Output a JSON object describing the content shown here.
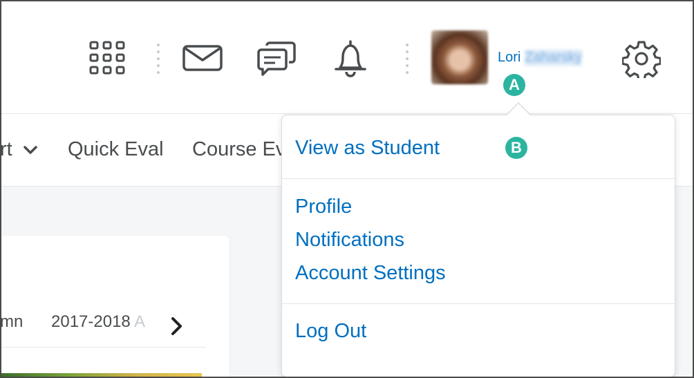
{
  "header": {
    "user": {
      "first_name": "Lori",
      "last_name_redacted": "Zaharsky"
    },
    "icons": [
      "waffle-grid-icon",
      "mail-icon",
      "chat-icon",
      "bell-icon",
      "gear-icon"
    ],
    "badges": {
      "a": "A",
      "b": "B"
    }
  },
  "navbar": {
    "items": [
      "rt",
      "Quick Eval",
      "Course Ev"
    ]
  },
  "card": {
    "left_text": "mn",
    "term": "2017-2018",
    "term_faded": "A"
  },
  "dropdown": {
    "items": [
      "View as Student",
      "Profile",
      "Notifications",
      "Account Settings",
      "Log Out"
    ]
  },
  "colors": {
    "link": "#006fbf",
    "badge": "#2bb5a0",
    "text": "#494c4e",
    "top_strip": "#006fbf"
  }
}
